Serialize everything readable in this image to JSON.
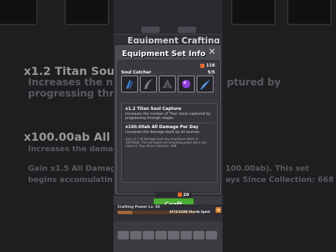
{
  "modal": {
    "title": "Equipment Set Info",
    "currency_amount": "116",
    "set_name": "Soul Catcher",
    "set_progress": "5/5",
    "bonus1": {
      "title": "x1.2 Titan Soul Capture",
      "desc": "Increases the number of Titan Souls captured by progressing through stages."
    },
    "bonus2": {
      "title": "x100.00ab All Damage Per Day",
      "desc": "Increases the damage dealt by all sources.",
      "note": "Gain x1.5 All Damage each day (maximum effect of 100.00ab). This set begins accumulating power when you unlock it. Days Since Collection: 668"
    },
    "craft_cost": "20",
    "craft_label": "Craft"
  },
  "background": {
    "header_title": "Equipment Crafting",
    "left_heading": "x1.2 Titan Soul C",
    "left_sub1": "Increases the nu",
    "left_sub2": "progressing throu",
    "left_heading2": "x100.00ab All Da",
    "left_sub3": "Increases the damag",
    "left_sub4": "Gain x1.5 All Damag",
    "left_sub5": "begins accumulatin",
    "right_sub1": "ptured by",
    "right_sub2": "100.00ab). This set",
    "right_sub3": "ays Since Collection: 668",
    "power_label": "Crafting Power Lv. 46",
    "power_progress": "4374/23386 Shards Spent",
    "power_fraction": 0.19
  },
  "colors": {
    "accent_green": "#4cae34",
    "soul_orange": "#e86a2c"
  }
}
